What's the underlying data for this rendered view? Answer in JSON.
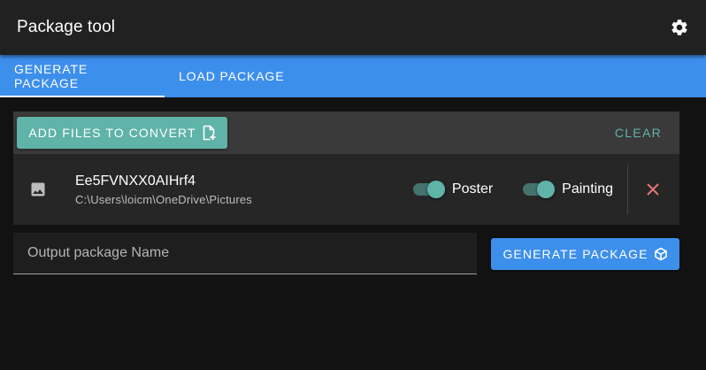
{
  "app": {
    "title": "Package tool",
    "settings_icon": "gear-icon"
  },
  "tabs": [
    {
      "label": "GENERATE PACKAGE",
      "active": true
    },
    {
      "label": "LOAD PACKAGE",
      "active": false
    }
  ],
  "toolbar": {
    "add_label": "ADD FILES TO CONVERT",
    "add_icon": "file-plus-icon",
    "clear_label": "CLEAR"
  },
  "files": [
    {
      "name": "Ee5FVNXX0AIHrf4",
      "path": "C:\\Users\\loicm\\OneDrive\\Pictures",
      "icon": "image-icon",
      "toggles": [
        {
          "label": "Poster",
          "on": true
        },
        {
          "label": "Painting",
          "on": true
        }
      ],
      "delete_icon": "close-icon"
    }
  ],
  "output": {
    "placeholder": "Output package Name",
    "value": ""
  },
  "generate": {
    "label": "GENERATE PACKAGE",
    "icon": "cube-icon"
  },
  "colors": {
    "appbar": "#212121",
    "tabs": "#3d8fec",
    "accent_teal": "#5fb3a8",
    "delete": "#e57373",
    "background": "#121212"
  }
}
